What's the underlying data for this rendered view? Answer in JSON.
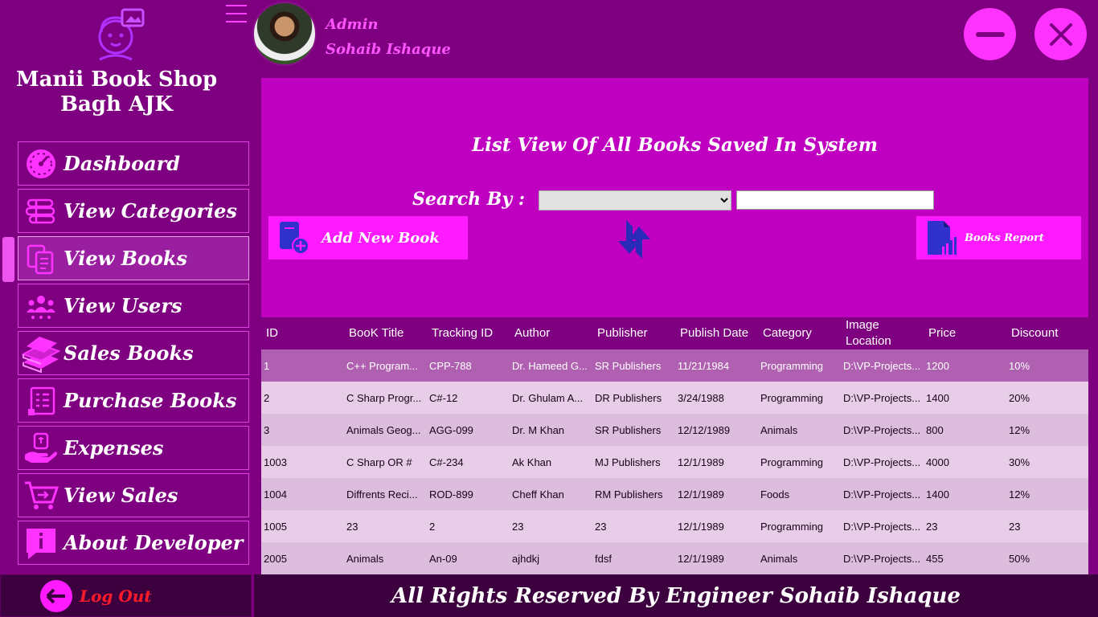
{
  "app": {
    "shop_name_line1": "Manii Book Shop",
    "shop_name_line2": "Bagh AJK"
  },
  "user": {
    "role": "Admin",
    "name": "Sohaib Ishaque"
  },
  "sidebar": {
    "items": [
      {
        "label": "Dashboard",
        "icon": "dashboard-gauge-icon"
      },
      {
        "label": "View Categories",
        "icon": "categories-icon"
      },
      {
        "label": "View Books",
        "icon": "books-copy-icon",
        "active": true
      },
      {
        "label": "View Users",
        "icon": "users-icon"
      },
      {
        "label": "Sales Books",
        "icon": "book-stack-icon"
      },
      {
        "label": "Purchase Books",
        "icon": "invoice-icon"
      },
      {
        "label": "Expenses",
        "icon": "hand-money-icon"
      },
      {
        "label": "View Sales",
        "icon": "cart-icon"
      },
      {
        "label": "About Developer",
        "icon": "info-icon"
      }
    ],
    "logout_label": "Log Out"
  },
  "panel": {
    "title": "List View Of All Books Saved In System",
    "search_label": "Search By :",
    "search_select_value": "",
    "search_text_value": "",
    "add_button": "Add New Book",
    "report_button": "Books Report"
  },
  "table": {
    "headers": [
      "ID",
      "BooK Title",
      "Tracking ID",
      "Author",
      "Publisher",
      "Publish Date",
      "Category",
      "Image Location",
      "Price",
      "Discount"
    ],
    "rows": [
      [
        "1",
        "C++ Program...",
        "CPP-788",
        "Dr. Hameed G...",
        "SR Publishers",
        "11/21/1984",
        "Programming",
        "D:\\VP-Projects...",
        "1200",
        "10%"
      ],
      [
        "2",
        "C Sharp Progr...",
        "C#-12",
        "Dr. Ghulam A...",
        "DR Publishers",
        "3/24/1988",
        "Programming",
        "D:\\VP-Projects...",
        "1400",
        "20%"
      ],
      [
        "3",
        "Animals Geog...",
        "AGG-099",
        "Dr. M Khan",
        "SR Publishers",
        "12/12/1989",
        "Animals",
        "D:\\VP-Projects...",
        "800",
        "12%"
      ],
      [
        "1003",
        "C Sharp OR #",
        "C#-234",
        "Ak Khan",
        "MJ Publishers",
        "12/1/1989",
        "Programming",
        "D:\\VP-Projects...",
        "4000",
        "30%"
      ],
      [
        "1004",
        "Diffrents Reci...",
        "ROD-899",
        "Cheff Khan",
        "RM Publishers",
        "12/1/1989",
        "Foods",
        "D:\\VP-Projects...",
        "1400",
        "12%"
      ],
      [
        "1005",
        "23",
        "2",
        "23",
        "23",
        "12/1/1989",
        "Programming",
        "D:\\VP-Projects...",
        "23",
        "23"
      ],
      [
        "2005",
        "Animals",
        "An-09",
        "ajhdkj",
        "fdsf",
        "12/1/1989",
        "Animals",
        "D:\\VP-Projects...",
        "455",
        "50%"
      ]
    ]
  },
  "footer": {
    "text": "All Rights Reserved By Engineer Sohaib Ishaque"
  },
  "colors": {
    "background": "#7e0080",
    "panel": "#c000c0",
    "accent": "#ff1aff",
    "footer": "#3d003f",
    "selected_row": "#b060b0"
  }
}
